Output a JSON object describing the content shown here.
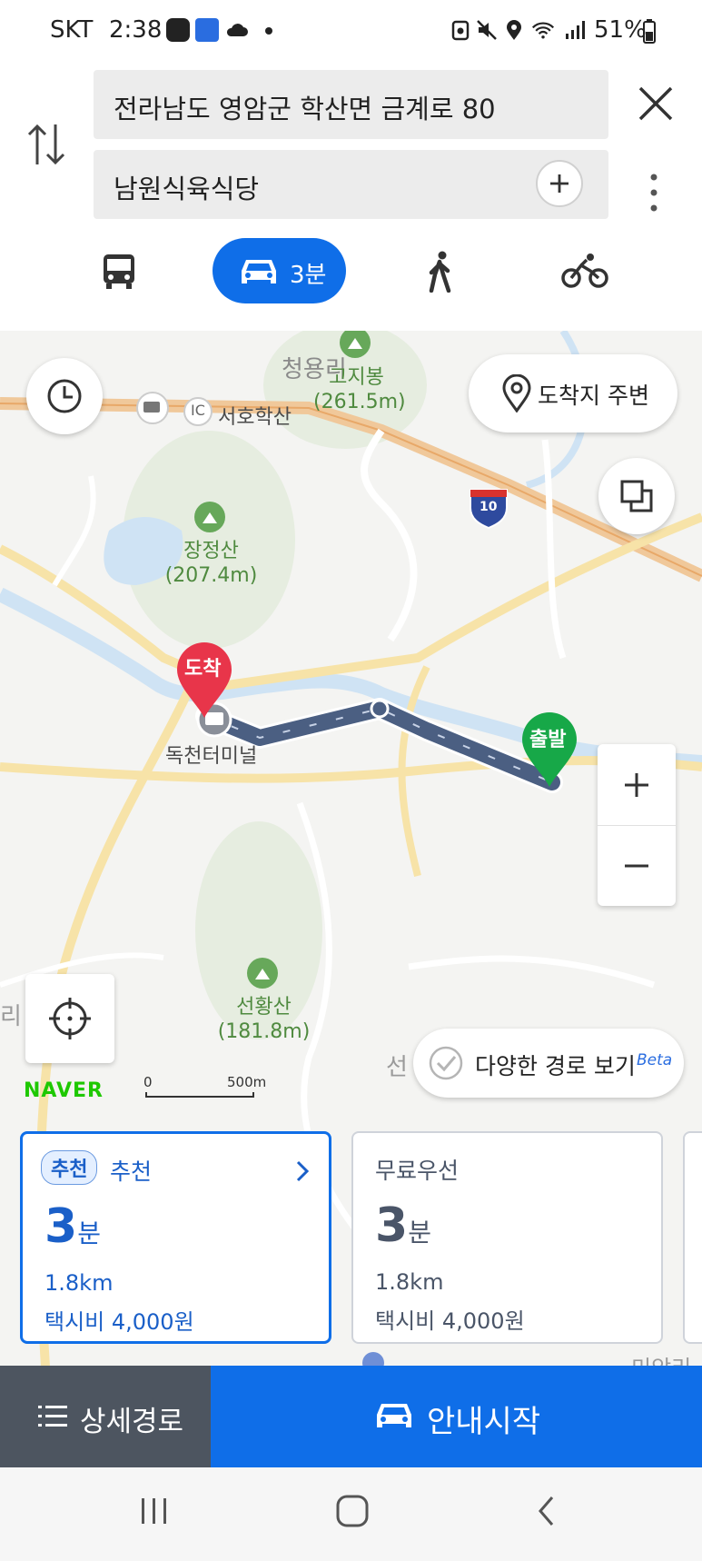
{
  "status_bar": {
    "carrier": "SKT",
    "time": "2:38",
    "battery": "51%",
    "icons": [
      "app-badge-icon",
      "calendar-app-icon",
      "cloud-icon",
      "dot-icon",
      "work-profile-icon",
      "mute-icon",
      "location-icon",
      "wifi-icon",
      "signal-icon",
      "battery-icon"
    ]
  },
  "search": {
    "origin": "전라남도 영암군 학산면 금계로 80",
    "destination": "남원식육식당"
  },
  "modes": {
    "car_time": "3분",
    "selected": "car"
  },
  "map": {
    "labels": {
      "cheongyong": "청용리",
      "gojibong": "고지봉",
      "gojibong_elev": "(261.5m)",
      "ic": "IC",
      "seoho_haksan": "서호학산",
      "jangjeongsan": "장정산",
      "jangjeongsan_elev": "(207.4m)",
      "highway": "10",
      "dokcheon": "독천터미널",
      "seonhwangsan": "선황산",
      "seonhwangsan_elev": "(181.8m)",
      "seon": "선",
      "ri": "리",
      "miam": "미암리"
    },
    "markers": {
      "arrival": "도착",
      "departure": "출발"
    },
    "nearby_destination": "도착지 주변",
    "various_routes": "다양한 경로 보기",
    "beta": "Beta",
    "brand": "NAVER",
    "scale": {
      "zero": "0",
      "distance": "500m"
    },
    "route_color": "#4b5f82"
  },
  "routes": [
    {
      "badge": "추천",
      "category": "추천",
      "time_value": "3",
      "time_unit": "분",
      "distance": "1.8km",
      "taxi_fare": "택시비 4,000원",
      "accent": "#1a5fc8"
    },
    {
      "category": "무료우선",
      "time_value": "3",
      "time_unit": "분",
      "distance": "1.8km",
      "taxi_fare": "택시비 4,000원",
      "accent": "#4a5568"
    }
  ],
  "actions": {
    "detail_route": "상세경로",
    "start_guidance": "안내시작"
  }
}
